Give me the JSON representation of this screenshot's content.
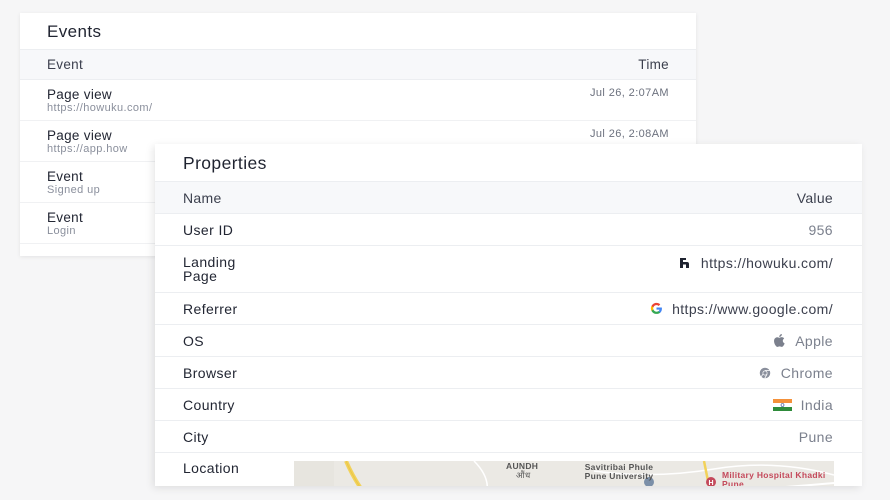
{
  "events": {
    "title": "Events",
    "columns": {
      "event": "Event",
      "time": "Time"
    },
    "rows": [
      {
        "name": "Page view",
        "sub": "https://howuku.com/",
        "time": "Jul 26, 2:07AM"
      },
      {
        "name": "Page view",
        "sub": "https://app.how",
        "time": "Jul 26, 2:08AM"
      },
      {
        "name": "Event",
        "sub": "Signed up",
        "time": ""
      },
      {
        "name": "Event",
        "sub": "Login",
        "time": ""
      }
    ]
  },
  "properties": {
    "title": "Properties",
    "columns": {
      "name": "Name",
      "value": "Value"
    },
    "user_id": {
      "name": "User ID",
      "value": "956"
    },
    "landing_page": {
      "name": "Landing Page",
      "value": "https://howuku.com/",
      "icon": "howuku-logo-icon"
    },
    "referrer": {
      "name": "Referrer",
      "value": "https://www.google.com/",
      "icon": "google-logo-icon"
    },
    "os": {
      "name": "OS",
      "value": "Apple",
      "icon": "apple-logo-icon"
    },
    "browser": {
      "name": "Browser",
      "value": "Chrome",
      "icon": "chrome-logo-icon"
    },
    "country": {
      "name": "Country",
      "value": "India",
      "icon": "india-flag-icon"
    },
    "city": {
      "name": "City",
      "value": "Pune"
    },
    "location": {
      "name": "Location",
      "map_labels": {
        "area": "AUNDH",
        "area_sub": "औंध",
        "university": "Savitribai Phule Pune University",
        "hospital": "Military Hospital Khadki Pune"
      }
    }
  },
  "colors": {
    "page_bg": "#f6f6f7",
    "card_bg": "#ffffff",
    "header_bg": "#f7f8fa",
    "value_text": "#7b808d",
    "map_road": "#f2d25a"
  }
}
